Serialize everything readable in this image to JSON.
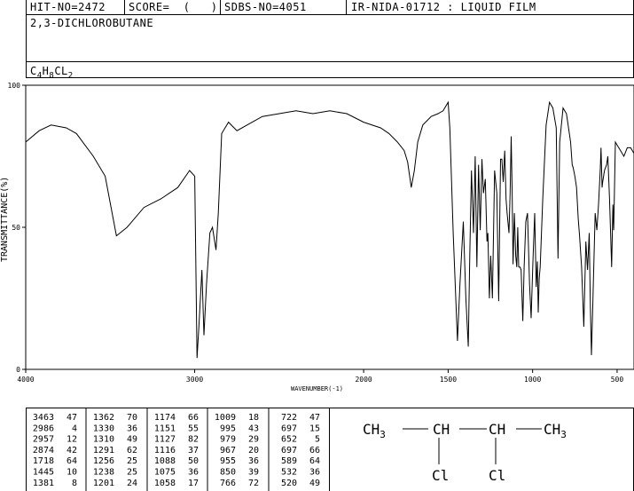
{
  "header": {
    "hit": "HIT-NO=2472",
    "score": "SCORE=  (   )",
    "sdbs": "SDBS-NO=4051",
    "ir": "IR-NIDA-01712 : LIQUID FILM"
  },
  "compound": {
    "name": "2,3-DICHLOROBUTANE",
    "formula": [
      {
        "t": "C",
        "sub": false
      },
      {
        "t": "4",
        "sub": true
      },
      {
        "t": "H",
        "sub": false
      },
      {
        "t": "8",
        "sub": true
      },
      {
        "t": "CL",
        "sub": false
      },
      {
        "t": "2",
        "sub": true
      }
    ]
  },
  "structure": {
    "top_groups": [
      "CH3",
      "CH",
      "CH",
      "CH3"
    ],
    "substituents": [
      "Cl",
      "Cl"
    ]
  },
  "chart_data": {
    "type": "line",
    "xlabel": "WAVENUMBER(-1)",
    "ylabel": "TRANSMITTANCE(%)",
    "xlim": [
      4000,
      400
    ],
    "ylim": [
      0,
      100
    ],
    "x_ticks": [
      4000,
      3000,
      2000,
      1500,
      1000,
      500
    ],
    "y_ticks": [
      0,
      50,
      100
    ],
    "series": [
      {
        "x": [
          4000,
          3920,
          3850,
          3760,
          3700,
          3600,
          3530,
          3463,
          3400,
          3300,
          3200,
          3100,
          3030,
          3000,
          2986,
          2975,
          2957,
          2945,
          2930,
          2910,
          2895,
          2874,
          2860,
          2840,
          2800,
          2750,
          2600,
          2400,
          2300,
          2200,
          2100,
          2000,
          1900,
          1850,
          1800,
          1760,
          1740,
          1718,
          1700,
          1680,
          1650,
          1600,
          1560,
          1530,
          1500,
          1490,
          1470,
          1445,
          1430,
          1410,
          1395,
          1381,
          1372,
          1362,
          1350,
          1340,
          1330,
          1320,
          1310,
          1300,
          1291,
          1280,
          1270,
          1265,
          1256,
          1248,
          1238,
          1225,
          1212,
          1201,
          1190,
          1182,
          1174,
          1165,
          1157,
          1151,
          1140,
          1133,
          1127,
          1121,
          1116,
          1108,
          1100,
          1094,
          1088,
          1082,
          1075,
          1068,
          1058,
          1050,
          1040,
          1030,
          1018,
          1009,
          1000,
          995,
          988,
          979,
          972,
          967,
          961,
          955,
          940,
          920,
          900,
          880,
          860,
          850,
          840,
          820,
          800,
          790,
          775,
          766,
          760,
          750,
          740,
          730,
          722,
          710,
          697,
          685,
          675,
          665,
          658,
          652,
          645,
          630,
          620,
          610,
          600,
          595,
          589,
          585,
          575,
          562,
          555,
          545,
          532,
          525,
          520,
          510,
          500,
          480,
          460,
          440,
          420,
          400
        ],
        "y": [
          80,
          84,
          86,
          85,
          83,
          75,
          68,
          47,
          50,
          57,
          60,
          64,
          70,
          68,
          4,
          15,
          35,
          12,
          30,
          48,
          50,
          42,
          55,
          83,
          87,
          84,
          89,
          91,
          90,
          91,
          90,
          87,
          85,
          83,
          80,
          77,
          73,
          64,
          70,
          80,
          86,
          89,
          90,
          91,
          94,
          85,
          48,
          10,
          30,
          52,
          25,
          8,
          40,
          70,
          48,
          75,
          36,
          72,
          49,
          74,
          62,
          67,
          45,
          48,
          25,
          40,
          25,
          70,
          62,
          24,
          74,
          74,
          66,
          77,
          60,
          55,
          48,
          62,
          82,
          62,
          37,
          55,
          40,
          36,
          50,
          36,
          36,
          35,
          17,
          36,
          52,
          55,
          30,
          18,
          35,
          43,
          55,
          29,
          38,
          20,
          32,
          36,
          60,
          86,
          94,
          92,
          85,
          39,
          80,
          92,
          90,
          86,
          80,
          72,
          71,
          68,
          64,
          53,
          47,
          36,
          15,
          45,
          35,
          48,
          22,
          5,
          20,
          55,
          49,
          58,
          70,
          78,
          64,
          66,
          70,
          72,
          75,
          60,
          36,
          58,
          49,
          80,
          79,
          77,
          75,
          78,
          78,
          76
        ]
      }
    ]
  },
  "peak_table": {
    "columns": [
      [
        [
          "3463",
          "47"
        ],
        [
          "2986",
          "4"
        ],
        [
          "2957",
          "12"
        ],
        [
          "2874",
          "42"
        ],
        [
          "1718",
          "64"
        ],
        [
          "1445",
          "10"
        ],
        [
          "1381",
          "8"
        ]
      ],
      [
        [
          "1362",
          "70"
        ],
        [
          "1330",
          "36"
        ],
        [
          "1310",
          "49"
        ],
        [
          "1291",
          "62"
        ],
        [
          "1256",
          "25"
        ],
        [
          "1238",
          "25"
        ],
        [
          "1201",
          "24"
        ]
      ],
      [
        [
          "1174",
          "66"
        ],
        [
          "1151",
          "55"
        ],
        [
          "1127",
          "82"
        ],
        [
          "1116",
          "37"
        ],
        [
          "1088",
          "50"
        ],
        [
          "1075",
          "36"
        ],
        [
          "1058",
          "17"
        ]
      ],
      [
        [
          "1009",
          "18"
        ],
        [
          "995",
          "43"
        ],
        [
          "979",
          "29"
        ],
        [
          "967",
          "20"
        ],
        [
          "955",
          "36"
        ],
        [
          "850",
          "39"
        ],
        [
          "766",
          "72"
        ]
      ],
      [
        [
          "722",
          "47"
        ],
        [
          "697",
          "15"
        ],
        [
          "652",
          "5"
        ],
        [
          "697",
          "66"
        ],
        [
          "589",
          "64"
        ],
        [
          "532",
          "36"
        ],
        [
          "520",
          "49"
        ]
      ]
    ]
  }
}
